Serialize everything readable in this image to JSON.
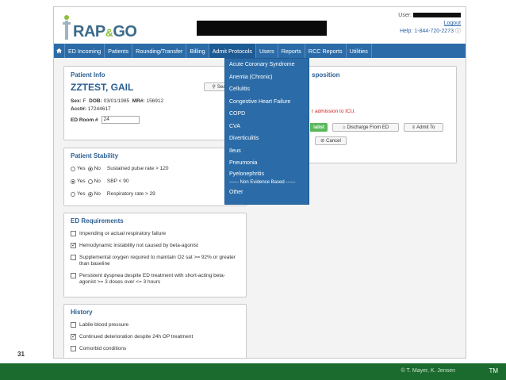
{
  "app": {
    "logo_text": "RAP",
    "logo_amp": "&",
    "logo_text2": "GO",
    "user_label": "User:",
    "logout": "Logout",
    "help": "Help: 1-844-720-2273"
  },
  "nav": {
    "items": [
      "ED Incoming",
      "Patients",
      "Rounding/Transfer",
      "Billing",
      "Admit Protocols",
      "Users",
      "Reports",
      "RCC Reports",
      "Utilities"
    ]
  },
  "dropdown": {
    "items": [
      "Acute Coronary Syndrome",
      "Anemia (Chronic)",
      "Cellulitis",
      "Congestive Heart Failure",
      "COPD",
      "CVA",
      "Diverticulitis",
      "Ileus",
      "Pneumonia",
      "Pyelonephritis"
    ],
    "separator": "------ Non Evidence Based ------",
    "other": "Other"
  },
  "patient": {
    "title": "Patient Info",
    "name": "ZZTEST, GAIL",
    "sex_label": "Sex:",
    "sex": "F",
    "dob_label": "DOB:",
    "dob": "03/01/1985",
    "mr_label": "MR#:",
    "mr": "156912",
    "acct_label": "Acct#:",
    "acct": "17244617",
    "room_label": "ED Room #",
    "room": "24",
    "search_label": "Sear"
  },
  "disposition": {
    "title": "sposition",
    "note": "r admission to ICU.",
    "specialist": "ialist",
    "discharge": "Discharge From ED",
    "admit": "Admit To",
    "cancel": "Cancel"
  },
  "stability": {
    "title": "Patient Stability",
    "yes": "Yes",
    "no": "No",
    "rows": [
      {
        "label": "Sustained pulse rate > 120",
        "selected": "no"
      },
      {
        "label": "SBP < 90",
        "selected": "yes"
      },
      {
        "label": "Respiratory rate > 29",
        "selected": "no"
      }
    ]
  },
  "ed_requirements": {
    "title": "ED Requirements",
    "items": [
      {
        "label": "Impending or actual respiratory failure",
        "checked": false
      },
      {
        "label": "Hemodynamic instability not caused by beta-agonist",
        "checked": true
      },
      {
        "label": "Supplemental oxygen required to maintain O2 sat >= 92% or greater than baseline",
        "checked": false
      },
      {
        "label": "Persistent dyspnea despite ED treatment with short-acting beta-agonist >= 3 doses over <= 3 hours",
        "checked": false
      }
    ]
  },
  "history": {
    "title": "History",
    "items": [
      {
        "label": "Labile blood pressure",
        "checked": false
      },
      {
        "label": "Continued deterioration despite 24h OP treatment",
        "checked": true
      },
      {
        "label": "Comorbid conditions",
        "checked": false
      }
    ]
  },
  "slide": {
    "number": "31",
    "copyright": "© T. Mayer, K. Jensen",
    "tm": "TM"
  }
}
